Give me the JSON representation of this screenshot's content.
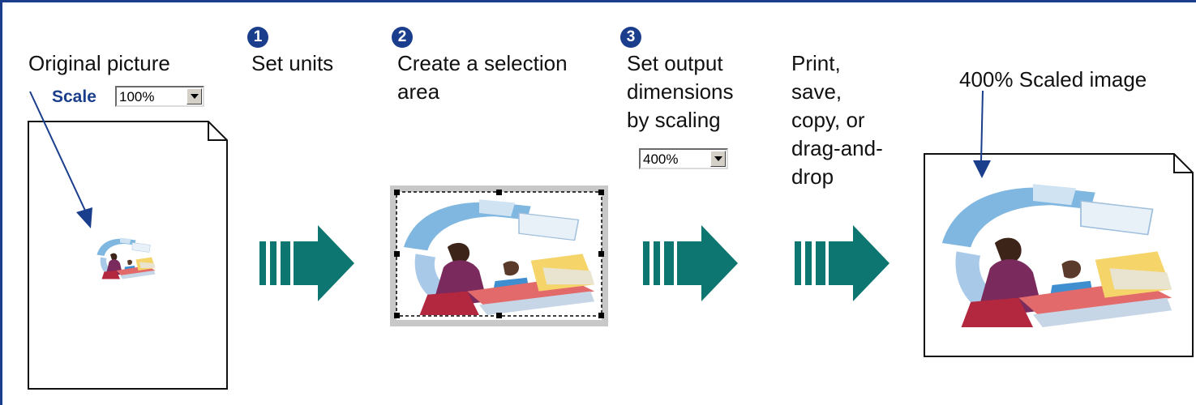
{
  "steps": {
    "original": {
      "label": "Original picture"
    },
    "step1": {
      "number": "1",
      "label": "Set units"
    },
    "step2": {
      "number": "2",
      "label_line1": "Create a selection",
      "label_line2": "area"
    },
    "step3": {
      "number": "3",
      "label_line1": "Set output",
      "label_line2": "dimensions",
      "label_line3": "by scaling"
    },
    "step4": {
      "line1": "Print,",
      "line2": "save,",
      "line3": "copy, or",
      "line4": "drag-and-",
      "line5": "drop"
    },
    "result": {
      "label": "400% Scaled image"
    }
  },
  "scale_control": {
    "label": "Scale",
    "value": "100%"
  },
  "output_scale_control": {
    "value": "400%"
  },
  "colors": {
    "accent": "#1a3e8c",
    "arrow": "#0e7670"
  }
}
